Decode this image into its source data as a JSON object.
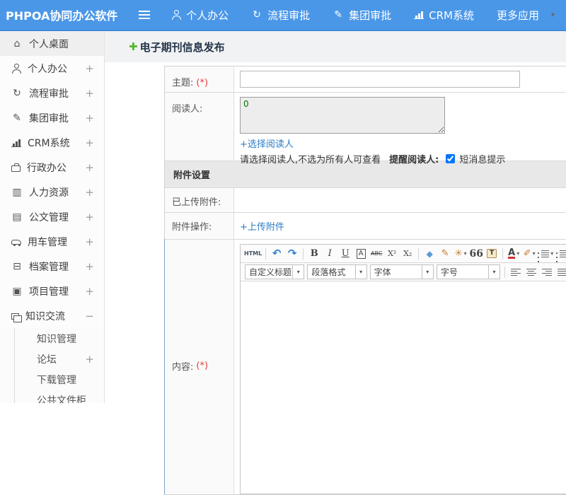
{
  "header": {
    "logo": "PHPOA协同办公软件",
    "nav": [
      {
        "label": "个人办公",
        "icon": "user-icon",
        "css": "i-person"
      },
      {
        "label": "流程审批",
        "icon": "workflow-icon",
        "g": "↻"
      },
      {
        "label": "集团审批",
        "icon": "group-approval-icon",
        "g": "✎"
      },
      {
        "label": "CRM系统",
        "icon": "crm-chart-icon",
        "css": "i-chart"
      },
      {
        "label": "更多应用",
        "icon": "more-apps",
        "caret": "▾"
      }
    ]
  },
  "sidebar": {
    "items": [
      {
        "label": "个人桌面",
        "icon": "home-icon",
        "g": "⌂",
        "expand": "",
        "active": true
      },
      {
        "label": "个人办公",
        "icon": "user-icon",
        "css": "i-person",
        "expand": "+"
      },
      {
        "label": "流程审批",
        "icon": "workflow-icon",
        "g": "↻",
        "expand": "+"
      },
      {
        "label": "集团审批",
        "icon": "group-approval-icon",
        "g": "✎",
        "expand": "+"
      },
      {
        "label": "CRM系统",
        "icon": "crm-chart-icon",
        "css": "i-chart",
        "expand": "+"
      },
      {
        "label": "行政办公",
        "icon": "briefcase-icon",
        "css": "i-case",
        "expand": "+"
      },
      {
        "label": "人力资源",
        "icon": "hr-icon",
        "g": "▥",
        "expand": "+"
      },
      {
        "label": "公文管理",
        "icon": "document-icon",
        "g": "▤",
        "expand": "+"
      },
      {
        "label": "用车管理",
        "icon": "car-icon",
        "css": "i-car",
        "expand": "+"
      },
      {
        "label": "档案管理",
        "icon": "archive-icon",
        "g": "⊟",
        "expand": "+"
      },
      {
        "label": "项目管理",
        "icon": "project-icon",
        "g": "▣",
        "expand": "+"
      },
      {
        "label": "知识交流",
        "icon": "knowledge-icon",
        "css": "i-copy",
        "expand": "−"
      }
    ],
    "subitems": [
      {
        "label": "知识管理",
        "expand": ""
      },
      {
        "label": "论坛",
        "expand": "+"
      },
      {
        "label": "下载管理",
        "expand": ""
      },
      {
        "label": "公共文件柜",
        "expand": ""
      }
    ]
  },
  "main": {
    "page_title": "电子期刊信息发布",
    "plus_glyph": "✚",
    "form": {
      "subject_label": "主题:",
      "required_mark": "(*)",
      "readers_label": "阅读人:",
      "readers_value": "0",
      "select_readers_link": "+选择阅读人",
      "readers_hint": "请选择阅读人,不选为所有人可查看",
      "remind_label": "提醒阅读人:",
      "sms_label": "短消息提示",
      "sms_checked": true,
      "attach_section_title": "附件设置",
      "uploaded_label": "已上传附件:",
      "attach_op_label": "附件操作:",
      "upload_link": "+上传附件",
      "content_label": "内容:"
    }
  },
  "editor": {
    "row1": [
      {
        "n": "html-source-button",
        "t": "g",
        "g": "HTML",
        "c": "html"
      },
      {
        "t": "s"
      },
      {
        "n": "undo-icon",
        "t": "g",
        "g": "↶",
        "c": "blue"
      },
      {
        "n": "redo-icon",
        "t": "g",
        "g": "↷",
        "c": "blue"
      },
      {
        "t": "s"
      },
      {
        "n": "bold-icon",
        "t": "g",
        "g": "B",
        "c": "b"
      },
      {
        "n": "italic-icon",
        "t": "g",
        "g": "I",
        "c": "i"
      },
      {
        "n": "underline-icon",
        "t": "g",
        "g": "U",
        "c": "u"
      },
      {
        "n": "font-border-icon",
        "t": "g",
        "g": "A",
        "c": "boxed"
      },
      {
        "n": "strikethrough-icon",
        "t": "g",
        "g": "ABC",
        "c": "strike"
      },
      {
        "n": "superscript-icon",
        "t": "g",
        "g": "X²",
        "c": "sm"
      },
      {
        "n": "subscript-icon",
        "t": "g",
        "g": "X₂",
        "c": "sm"
      },
      {
        "t": "s"
      },
      {
        "n": "eraser-icon",
        "t": "g",
        "g": "◆",
        "c": "erase"
      },
      {
        "n": "format-brush-icon",
        "t": "g",
        "g": "✎",
        "c": "orange"
      },
      {
        "n": "autotypeset-icon",
        "t": "g",
        "g": "✳",
        "c": "orange",
        "a": true
      },
      {
        "n": "blockquote-icon",
        "t": "g",
        "g": "66",
        "c": "quote"
      },
      {
        "n": "paste-word-icon",
        "t": "g",
        "g": "T",
        "c": "paste"
      },
      {
        "t": "s"
      },
      {
        "n": "font-color-icon",
        "t": "g",
        "g": "A",
        "c": "fcolor",
        "a": true
      },
      {
        "n": "highlight-icon",
        "t": "g",
        "g": "✐",
        "c": "orange",
        "a": true
      },
      {
        "n": "ordered-list-icon",
        "t": "bars",
        "c": "ln",
        "a": true
      },
      {
        "n": "unordered-list-icon",
        "t": "bars",
        "c": "ld"
      }
    ],
    "row2": [
      {
        "n": "custom-title-select",
        "t": "sel",
        "label": "自定义标题",
        "w": 86
      },
      {
        "n": "paragraph-select",
        "t": "sel",
        "label": "段落格式",
        "w": 86
      },
      {
        "n": "font-family-select",
        "t": "sel",
        "label": "字体",
        "w": 92
      },
      {
        "n": "font-size-select",
        "t": "sel",
        "label": "字号",
        "w": 92
      },
      {
        "t": "s"
      },
      {
        "n": "align-left-icon",
        "t": "bars",
        "c": "al"
      },
      {
        "n": "align-center-icon",
        "t": "bars",
        "c": "ac"
      },
      {
        "n": "align-right-icon",
        "t": "bars",
        "c": "ar"
      },
      {
        "n": "justify-icon",
        "t": "bars",
        "c": "aj"
      },
      {
        "n": "link-icon",
        "t": "g",
        "g": "∞",
        "c": "gray"
      },
      {
        "n": "unlink-icon",
        "t": "g",
        "g": "∞",
        "c": "gray cut"
      },
      {
        "n": "image-icon",
        "t": "pic"
      },
      {
        "n": "screenshot-icon",
        "t": "pic"
      }
    ]
  },
  "colors": {
    "header_blue": "#4a97e8",
    "link_blue": "#2d7dc5",
    "required_red": "#e53b3b",
    "plus_green": "#55b82e",
    "textarea_text_green": "#007700",
    "section_bar_gray": "#e8e8e8"
  }
}
